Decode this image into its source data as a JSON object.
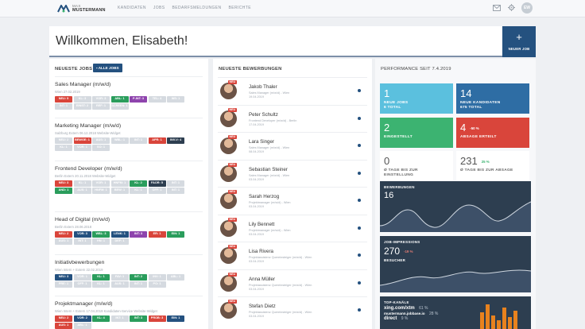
{
  "logo": {
    "line1": "MAX",
    "line2": "MUSTERMANN"
  },
  "nav": [
    "KANDIDATEN",
    "JOBS",
    "BEDARFSMELDUNGEN",
    "BERICHTE"
  ],
  "user": {
    "initials": "EW"
  },
  "welcome": "Willkommen, Elisabeth!",
  "new_job": {
    "label": "NEUER JOB"
  },
  "jobs_panel": {
    "title": "NEUESTE JOBS",
    "all_jobs": "ALLE JOBS"
  },
  "jobs": [
    {
      "title": "Sales Manager (m/w/d)",
      "meta": "Wien      27.02.2019",
      "chips": [
        [
          "NEU: 5",
          "r"
        ],
        [
          "KL: 3",
          "l"
        ],
        [
          "VOR: 3",
          "l"
        ],
        [
          "ABL: 1",
          "g"
        ],
        [
          "P-INT: 3",
          "v"
        ],
        [
          "TEL: 4",
          "l"
        ],
        [
          "WS: 1",
          "l"
        ],
        [
          "INT: 1",
          "l"
        ],
        [
          "EINST: 2",
          "l"
        ],
        [
          "REF: 1",
          "l"
        ],
        [
          "SCREEN: 1",
          "l"
        ]
      ]
    },
    {
      "title": "Marketing Manager (m/w/d)",
      "meta": "Salzburg    Extern    06.12.2018    Website-Widget",
      "chips": [
        [
          "NEU: 2",
          "l"
        ],
        [
          "BEWGE: 1",
          "r"
        ],
        [
          "AUS: 1",
          "l"
        ],
        [
          "WBL: 1",
          "l"
        ],
        [
          "INT: 1",
          "l"
        ],
        [
          "APR: 1",
          "r"
        ],
        [
          "INV-V: 4",
          "n"
        ],
        [
          "KL: 1",
          "l"
        ],
        [
          "VOR: 1",
          "l"
        ],
        [
          "SO: 1",
          "l"
        ]
      ]
    },
    {
      "title": "Frontend Developer (m/w/d)",
      "meta": "Berlin    Extern    20.11.2018    Website-Widget",
      "chips": [
        [
          "NEU: 3",
          "r"
        ],
        [
          "KL: 1",
          "l"
        ],
        [
          "VOR: 1",
          "l"
        ],
        [
          "HNFM: 1",
          "l"
        ],
        [
          "KL: 2",
          "g"
        ],
        [
          "FAOR: 5",
          "n"
        ],
        [
          "INT: 1",
          "l"
        ],
        [
          "AND: 1",
          "g"
        ],
        [
          "AUS: 1",
          "l"
        ],
        [
          "HNFM: 1",
          "l"
        ],
        [
          "BEW: 1",
          "l"
        ],
        [
          "KL: 1",
          "l"
        ],
        [
          "OFF: 1",
          "l"
        ],
        [
          "INT: 1",
          "l"
        ]
      ]
    },
    {
      "title": "Head of Digital (m/w/d)",
      "meta": "Berlin    Extern    28.06.2018",
      "chips": [
        [
          "NEU: 2",
          "r"
        ],
        [
          "VOR: 3",
          "cb"
        ],
        [
          "WBL: 3",
          "g"
        ],
        [
          "I-ENK: 1",
          "cb"
        ],
        [
          "INT: 3",
          "v"
        ],
        [
          "ER: 1",
          "r"
        ],
        [
          "EIN: 1",
          "g"
        ],
        [
          "AUS: 1",
          "l"
        ],
        [
          "INT: 1",
          "l"
        ],
        [
          "HN: 1",
          "l"
        ],
        [
          "DEF: 1",
          "l"
        ]
      ]
    },
    {
      "title": "Initiativbewerbungen",
      "meta": "Wien    Intern + Extern    22.02.2019",
      "chips": [
        [
          "NEU: 3",
          "cb"
        ],
        [
          "VOR: 1",
          "l"
        ],
        [
          "KL: 1",
          "g"
        ],
        [
          "FAV: 1",
          "l"
        ],
        [
          "INT: 2",
          "g"
        ],
        [
          "INV: 1",
          "l"
        ],
        [
          "ABL: 1",
          "l"
        ],
        [
          "PRE: 1",
          "l"
        ],
        [
          "OFF: 1",
          "l"
        ],
        [
          "KL: 1",
          "l"
        ],
        [
          "AUS: 1",
          "l"
        ],
        [
          "INT: 1",
          "l"
        ],
        [
          "PO: 1",
          "l"
        ]
      ]
    },
    {
      "title": "Projektmanager (m/w/d)",
      "meta": "Wien    Intern + Extern    17.04.2019    Kandidaten-Service    Website-Widget",
      "chips": [
        [
          "NEU: 2",
          "r"
        ],
        [
          "VOR: 2",
          "cb"
        ],
        [
          "KL: 4",
          "g"
        ],
        [
          "INT: 1",
          "l"
        ],
        [
          "INT: 3",
          "g"
        ],
        [
          "PROB: 3",
          "r"
        ],
        [
          "EIN: 1",
          "cb"
        ],
        [
          "AUS: 1",
          "r"
        ],
        [
          "ABL: 1",
          "l"
        ]
      ]
    }
  ],
  "applications_panel": {
    "title": "NEUESTE BEWERBUNGEN"
  },
  "applications": [
    {
      "name": "Jakob Thaler",
      "role": "Sales Manager (m/w/d) - Wien",
      "date": "19.04.2019"
    },
    {
      "name": "Peter Schultz",
      "role": "Frontend Developer (m/w/d) - Berlin",
      "date": "17.04.2019"
    },
    {
      "name": "Lara Singer",
      "role": "Sales Manager (m/w/d) - Wien",
      "date": "08.04.2019"
    },
    {
      "name": "Sebastian Steiner",
      "role": "Sales Manager (m/w/d) - Wien",
      "date": "03.04.2019"
    },
    {
      "name": "Sarah Herzog",
      "role": "Projektmanager (m/w/d) - Wien",
      "date": "03.04.2019"
    },
    {
      "name": "Lily Bennett",
      "role": "Projektmanager (m/w/d) - Wien",
      "date": "03.04.2019"
    },
    {
      "name": "Lisa Rivera",
      "role": "Projektassistenz Quereinsteiger (m/w/d) - Wien",
      "date": "03.04.2019"
    },
    {
      "name": "Anna Müller",
      "role": "Projektassistenz Quereinsteiger (m/w/d) - Wien",
      "date": "03.04.2019"
    },
    {
      "name": "Stefan Dietz",
      "role": "Projektassistenz Quereinsteiger (m/w/d) - Wien",
      "date": "03.04.2019"
    }
  ],
  "new_badge": "NEU",
  "performance": {
    "title": "PERFORMANCE SEIT 7.4.2019",
    "tiles": [
      {
        "value": "1",
        "label": "NEUE JOBS",
        "sub": "6 TOTAL",
        "color": "#5bc0de"
      },
      {
        "value": "14",
        "label": "NEUE KANDIDATEN",
        "sub": "675 TOTAL",
        "color": "#2e6da4"
      },
      {
        "value": "2",
        "label": "EINGESTELLT",
        "sub": "",
        "color": "#3cb371"
      },
      {
        "value": "4",
        "label": "ABSAGE ERTEILT",
        "sub": "",
        "trend": "-50 %",
        "color": "#d9453b"
      },
      {
        "value": "0",
        "label": "Ø TAGE BIS ZUR",
        "sub": "EINSTELLUNG",
        "color": "#ffffff"
      },
      {
        "value": "231",
        "label": "Ø TAGE BIS ZUR ABSAGE",
        "sub": "",
        "trend": "25 %",
        "color": "#ffffff"
      }
    ],
    "applications_chart": {
      "label": "BEWERBUNGEN",
      "value": "16"
    },
    "impressions": {
      "label": "JOB-IMPRESSIONS",
      "value": "270",
      "trend": "-19 %",
      "sub": "BESUCHER"
    },
    "channels": {
      "label": "TOP-KANÄLE",
      "items": [
        {
          "name": "xing.com/xtm",
          "pct": "61 %"
        },
        {
          "name": "mustermann.jobbase.io",
          "pct": "28 %"
        },
        {
          "name": "direct",
          "pct": "9 %"
        }
      ]
    }
  }
}
